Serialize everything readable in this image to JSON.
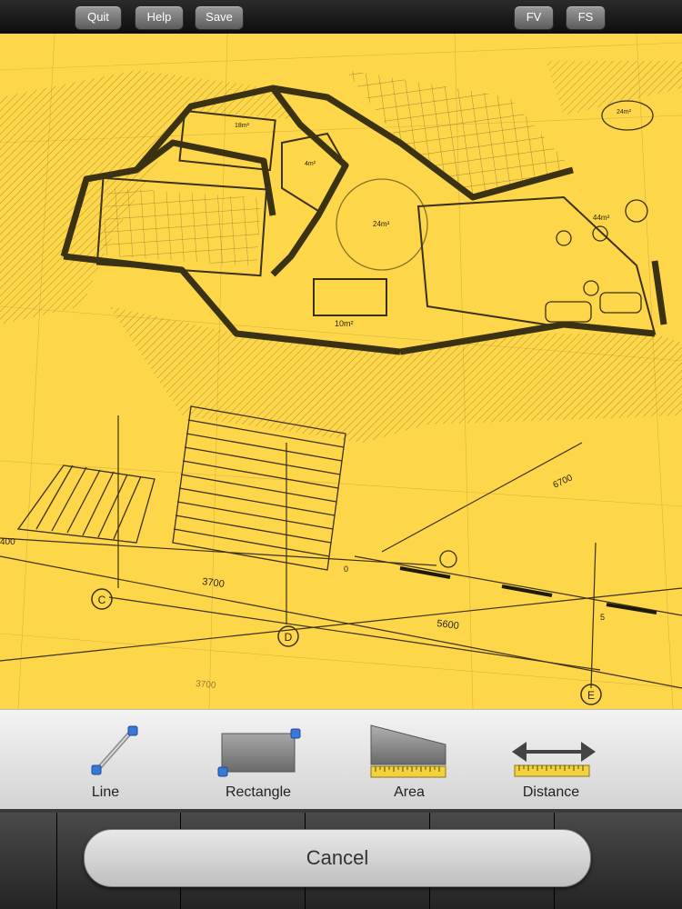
{
  "toolbar": {
    "quit_label": "Quit",
    "help_label": "Help",
    "save_label": "Save",
    "fv_label": "FV",
    "fs_label": "FS"
  },
  "blueprint": {
    "background": "#fdd64a",
    "dimension_labels": [
      "3700",
      "5600",
      "6700",
      "3700",
      "400",
      "0",
      "5"
    ],
    "room_labels": [
      "10m²",
      "24m²",
      "44m²",
      "18m²",
      "4m²",
      "24m²"
    ],
    "grid_markers": [
      "C",
      "D",
      "E"
    ]
  },
  "tools": {
    "line_label": "Line",
    "rectangle_label": "Rectangle",
    "area_label": "Area",
    "distance_label": "Distance"
  },
  "actions": {
    "cancel_label": "Cancel"
  },
  "colors": {
    "accent_handle": "#3a78d8",
    "ruler": "#f3d23e"
  }
}
